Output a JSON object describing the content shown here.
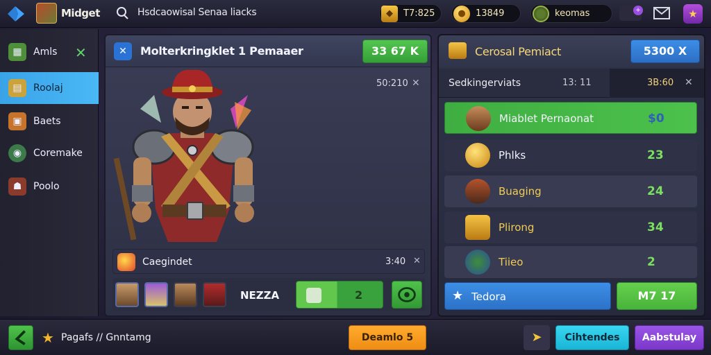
{
  "topbar": {
    "app_title": "Midget",
    "search_text": "Hsdcaowisal Senaa liacks",
    "resources": [
      {
        "icon": "shield-coin-icon",
        "value": "T7:825"
      },
      {
        "icon": "gold-coin-icon",
        "value": "13849"
      },
      {
        "icon": "gem-icon",
        "value": "keomas"
      }
    ],
    "mail_badge": "+"
  },
  "sidebar": {
    "items": [
      {
        "label": "Amls",
        "icon": "map-icon",
        "active": false
      },
      {
        "label": "Roolaj",
        "icon": "scroll-icon",
        "active": true
      },
      {
        "label": "Baets",
        "icon": "chest-icon",
        "active": false
      },
      {
        "label": "Coremake",
        "icon": "globe-icon",
        "active": false
      },
      {
        "label": "Poolo",
        "icon": "hero-icon",
        "active": false
      }
    ]
  },
  "left_panel": {
    "title": "Molterkringklet 1 Pemaaer",
    "button_label": "33 67 K",
    "timer": "50:210",
    "quest_bar": {
      "label": "Caegindet",
      "time": "3:40"
    },
    "party": {
      "name": "NEZZA",
      "count": "2"
    }
  },
  "right_panel": {
    "title": "Cerosal Pemiact",
    "button_label": "5300 X",
    "sub_header": {
      "label": "Sedkingerviats",
      "time": "13: 11",
      "value": "3B:60"
    },
    "rows": [
      {
        "label": "Miablet Pernaonat",
        "value": "$0",
        "style": "sel"
      },
      {
        "label": "Phlks",
        "value": "23",
        "style": "normal"
      },
      {
        "label": "Buaging",
        "value": "24",
        "style": "alt"
      },
      {
        "label": "Plirong",
        "value": "34",
        "style": "normal"
      },
      {
        "label": "Tiieo",
        "value": "2",
        "style": "alt"
      }
    ],
    "footer": {
      "left_label": "Tedora",
      "right_label": "M7 17"
    }
  },
  "bottombar": {
    "label": "Pagafs // Gnntamg",
    "orange_button": "Deamlo 5",
    "cyan_button": "Cihtendes",
    "purple_button": "Aabstulay"
  },
  "colors": {
    "accent_green": "#4cc14b",
    "accent_blue": "#3d8de6",
    "gold": "#f2cc52",
    "sidebar_active": "#49b8f5"
  }
}
